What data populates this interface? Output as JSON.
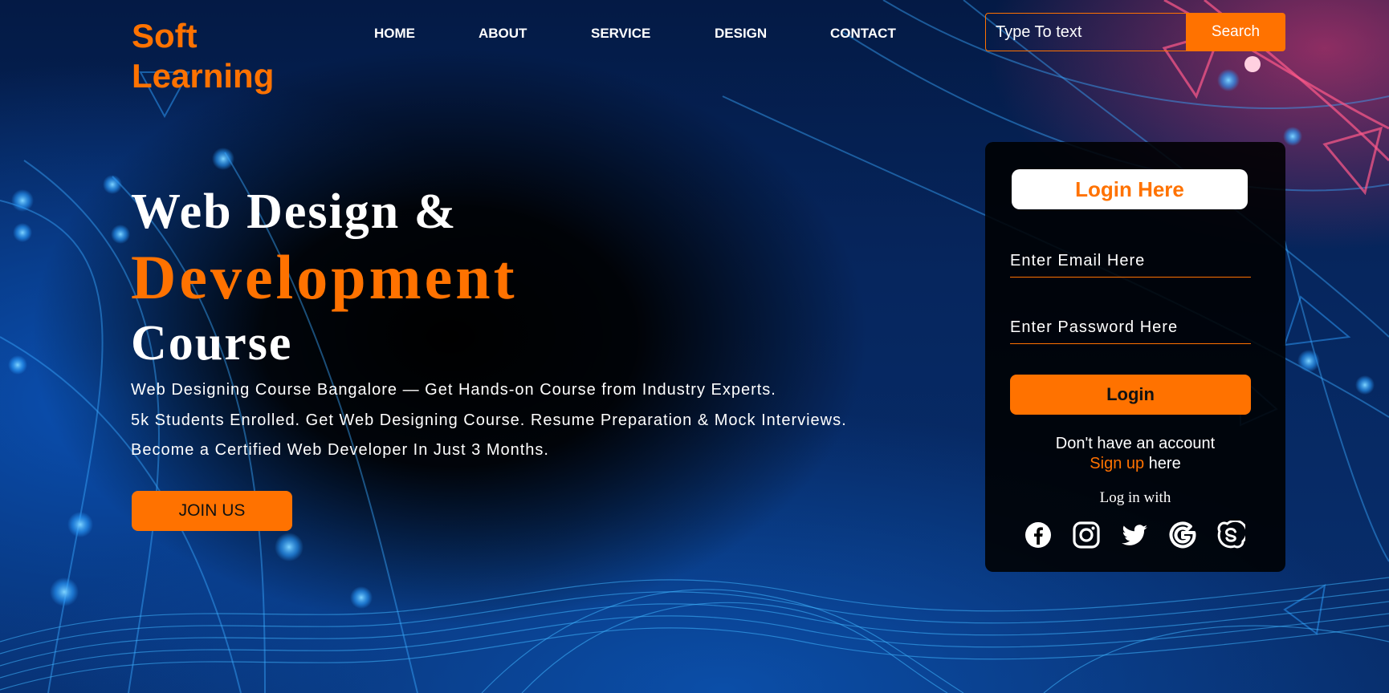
{
  "brand": {
    "name": "Soft Learning"
  },
  "nav": {
    "items": [
      "HOME",
      "ABOUT",
      "SERVICE",
      "DESIGN",
      "CONTACT"
    ]
  },
  "search": {
    "placeholder": "Type To text",
    "button_label": "Search"
  },
  "hero": {
    "title_line1": "Web Design &",
    "title_line2": "Development",
    "title_line3": "Course",
    "description": [
      "Web Designing Course Bangalore — Get Hands-on Course from Industry Experts.",
      "5k Students Enrolled. Get Web Designing Course. Resume Preparation & Mock Interviews.",
      "Become a Certified Web Developer In Just 3 Months."
    ],
    "cta_label": "JOIN US"
  },
  "login": {
    "title": "Login Here",
    "email_placeholder": "Enter Email Here",
    "password_placeholder": "Enter Password Here",
    "button_label": "Login",
    "no_account_text": "Don't have an account",
    "signup_link": "Sign up",
    "signup_suffix": " here",
    "log_in_with": "Log in with",
    "social_icons": [
      "facebook-icon",
      "instagram-icon",
      "twitter-icon",
      "google-icon",
      "skype-icon"
    ]
  },
  "colors": {
    "accent": "#ff7200",
    "text": "#ffffff",
    "card_bg": "#000000"
  }
}
